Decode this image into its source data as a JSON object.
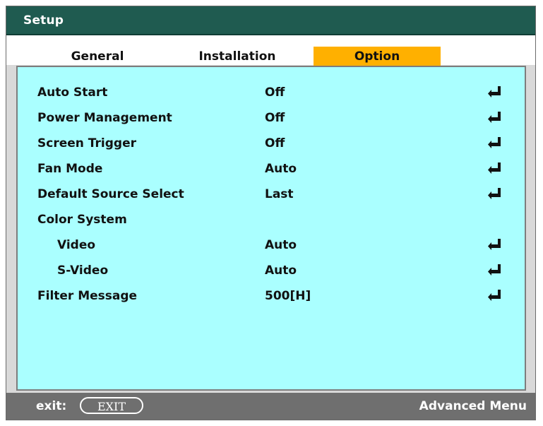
{
  "window": {
    "title": "Setup"
  },
  "tabs": [
    {
      "label": "General",
      "selected": false
    },
    {
      "label": "Installation",
      "selected": false
    },
    {
      "label": "Option",
      "selected": true
    }
  ],
  "rows": [
    {
      "label": "Auto Start",
      "value": "Off",
      "enter_icon": true
    },
    {
      "label": "Power Management",
      "value": "Off",
      "enter_icon": true
    },
    {
      "label": "Screen Trigger",
      "value": "Off",
      "enter_icon": true
    },
    {
      "label": "Fan Mode",
      "value": "Auto",
      "enter_icon": true
    },
    {
      "label": "Default Source Select",
      "value": "Last",
      "enter_icon": true
    },
    {
      "label": "Color System",
      "value": "",
      "enter_icon": false
    },
    {
      "label": "Video",
      "value": "Auto",
      "enter_icon": true
    },
    {
      "label": "S-Video",
      "value": "Auto",
      "enter_icon": true
    },
    {
      "label": "Filter Message",
      "value": "500[H]",
      "enter_icon": true
    }
  ],
  "footer": {
    "exit_label": "exit:",
    "exit_key": "EXIT",
    "advanced_menu": "Advanced Menu"
  },
  "colors": {
    "titlebar": "#1f5b50",
    "selected_tab": "#ffb000",
    "panel": "#aaffff",
    "footer": "#6f6f6f"
  },
  "icons": {
    "enter": "enter-return-icon"
  }
}
